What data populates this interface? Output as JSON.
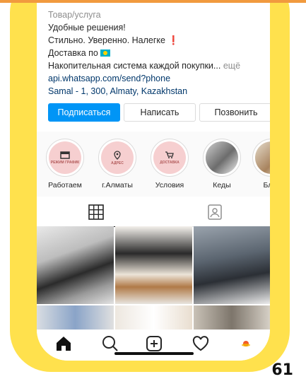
{
  "profile": {
    "category": "Товар/услуга",
    "bio_line1": "Удобные решения!",
    "bio_line2": "Стильно. Уверенно. Налегке",
    "bio_line3": "Доставка по",
    "bio_line4": "Накопительная система каждой покупки...",
    "more_label": "ещё",
    "link": "api.whatsapp.com/send?phone",
    "address": "Samal - 1, 300, Almaty, Kazakhstan"
  },
  "actions": {
    "subscribe": "Подписаться",
    "message": "Написать",
    "call": "Позвонить"
  },
  "highlights": [
    {
      "label": "Работаем",
      "cover_text": "РЕЖИМ ГРАФИК"
    },
    {
      "label": "г.Алматы",
      "cover_text": "АДРЕС"
    },
    {
      "label": "Условия",
      "cover_text": "ДОСТАВКА"
    },
    {
      "label": "Кеды",
      "cover_text": ""
    },
    {
      "label": "Блуз",
      "cover_text": ""
    }
  ],
  "tabs": [
    "grid-icon",
    "tagged-icon"
  ],
  "nav": [
    "home-icon",
    "search-icon",
    "new-post-icon",
    "activity-icon",
    "profile-avatar"
  ],
  "colors": {
    "frame": "#ffe14d",
    "accent": "#0095f6",
    "link": "#00376b"
  },
  "page_number": "61"
}
